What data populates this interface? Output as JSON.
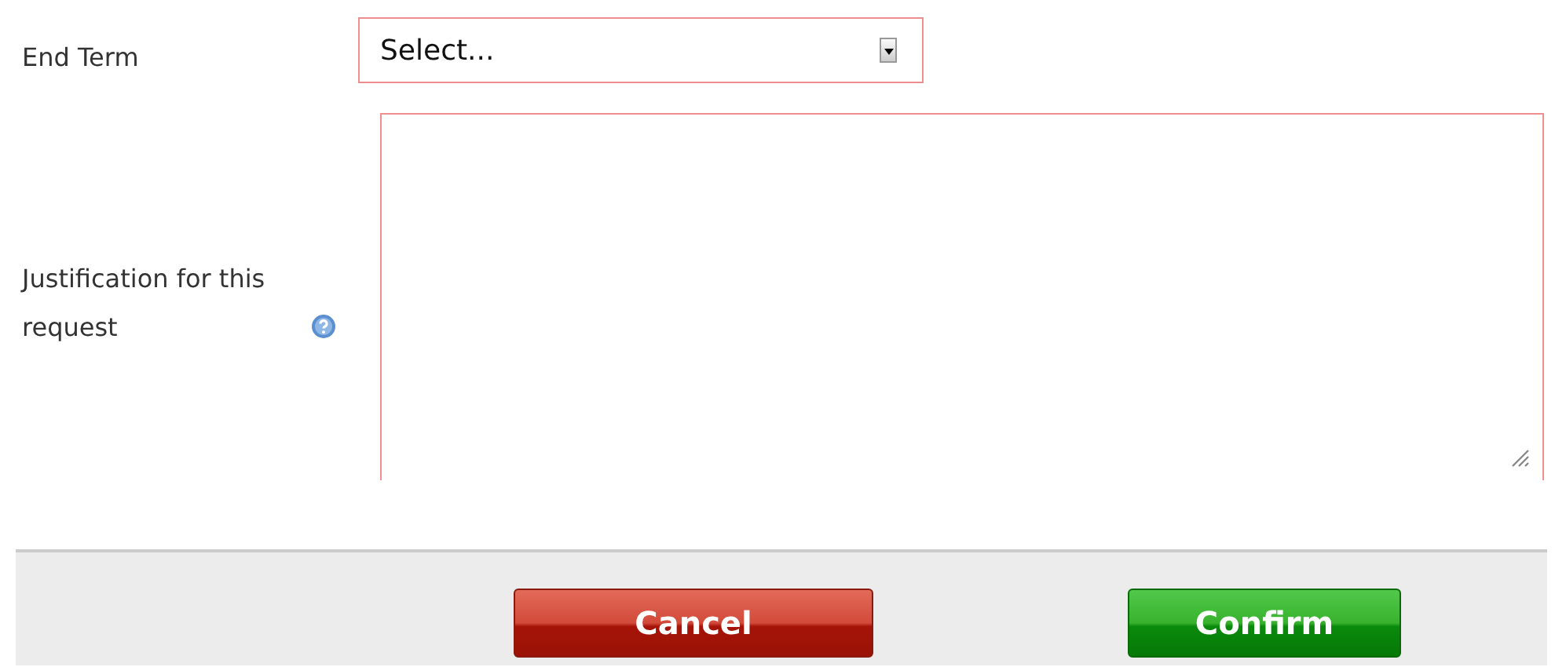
{
  "fields": [
    {
      "kind": "select",
      "label": "End Term",
      "value": "Select...",
      "error": true,
      "help": false
    },
    {
      "kind": "textarea",
      "label": "Justification for this request",
      "error": true,
      "help": true
    }
  ],
  "buttons": [
    {
      "label": "Cancel",
      "kind": "danger"
    },
    {
      "label": "Confirm",
      "kind": "primary"
    }
  ]
}
